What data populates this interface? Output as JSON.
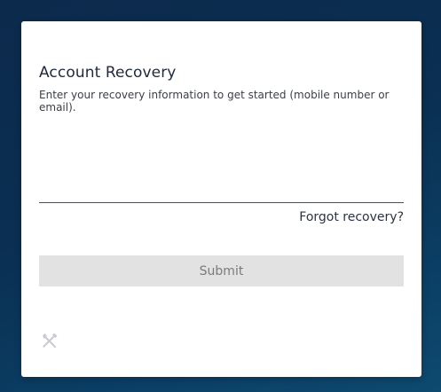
{
  "card": {
    "title": "Account Recovery",
    "subtitle": "Enter your recovery information to get started (mobile number or email).",
    "input": {
      "value": "",
      "placeholder": ""
    },
    "forgot_link": "Forgot recovery?",
    "submit_label": "Submit",
    "footer_icon": "tools-icon"
  },
  "colors": {
    "background": "#0a2f52",
    "card": "#ffffff",
    "button_disabled_bg": "#e2e2e2",
    "button_disabled_text": "#7a7a7a"
  }
}
